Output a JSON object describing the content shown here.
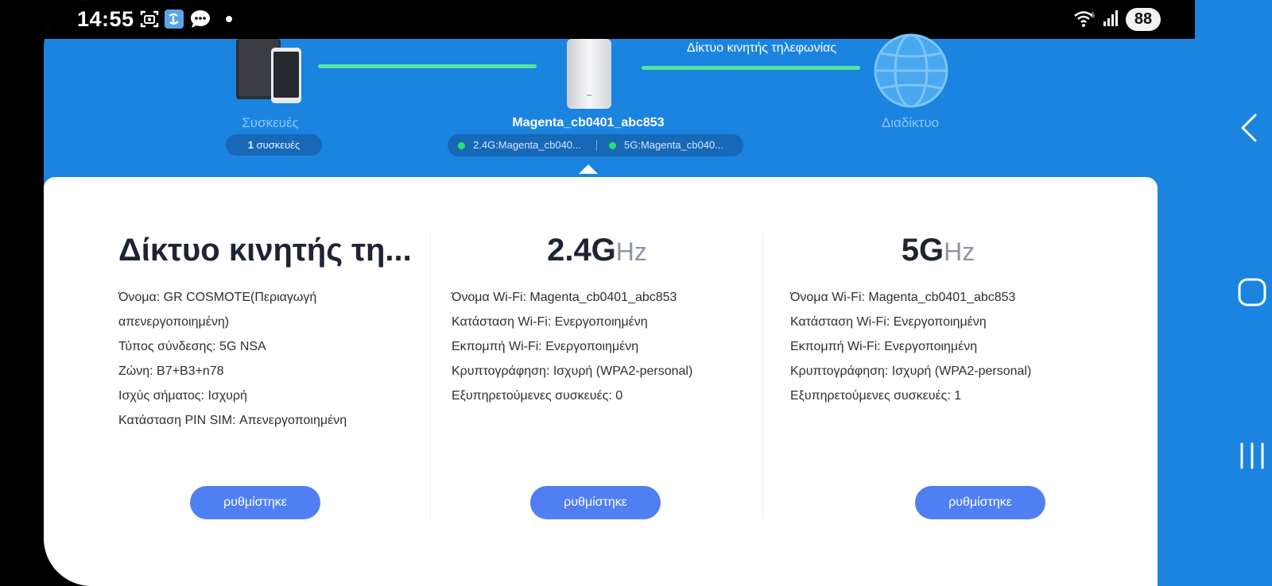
{
  "status_bar": {
    "time": "14:55",
    "battery": "88",
    "icons": [
      "screenshot-icon",
      "app-badge-icon",
      "chat-icon",
      "dot-icon",
      "wifi-icon",
      "signal-icon"
    ]
  },
  "topology": {
    "devices_label": "Συσκευές",
    "devices_count": "1",
    "devices_count_suffix": " συσκευές",
    "router_name": "Magenta_cb0401_abc853",
    "ssid_24": "2.4G:Magenta_cb040...",
    "ssid_5": "5G:Magenta_cb040...",
    "mobile_network_label": "Δίκτυο κινητής τηλεφωνίας",
    "internet_label": "Διαδίκτυο",
    "colors": {
      "background": "#1a84e0",
      "link_line": "#53e6a0",
      "status_dot": "#28e26a"
    }
  },
  "mobile_network": {
    "title": "Δίκτυο κινητής τη...",
    "lines": [
      "Όνομα: GR COSMOTE(Περιαγωγή",
      "απενεργοποιημένη)",
      "Τύπος σύνδεσης: 5G NSA",
      "Ζώνη: B7+B3+n78",
      "Ισχύς σήματος: Ισχυρή",
      "Κατάσταση PIN SIM: Απενεργοποιημένη"
    ],
    "button": "ρυθμίστηκε"
  },
  "wifi_24": {
    "title_main": "2.4G",
    "title_unit": "Hz",
    "lines": [
      "Όνομα Wi-Fi: Magenta_cb0401_abc853",
      "Κατάσταση Wi-Fi: Ενεργοποιημένη",
      "Εκπομπή Wi-Fi: Ενεργοποιημένη",
      "Κρυπτογράφηση: Ισχυρή (WPA2-personal)",
      "Εξυπηρετούμενες συσκευές: 0"
    ],
    "button": "ρυθμίστηκε"
  },
  "wifi_5": {
    "title_main": "5G",
    "title_unit": "Hz",
    "lines": [
      "Όνομα Wi-Fi: Magenta_cb0401_abc853",
      "Κατάσταση Wi-Fi: Ενεργοποιημένη",
      "Εκπομπή Wi-Fi: Ενεργοποιημένη",
      "Κρυπτογράφηση: Ισχυρή (WPA2-personal)",
      "Εξυπηρετούμενες συσκευές: 1"
    ],
    "button": "ρυθμίστηκε"
  },
  "nav": [
    "back-icon",
    "home-icon",
    "recents-icon"
  ]
}
